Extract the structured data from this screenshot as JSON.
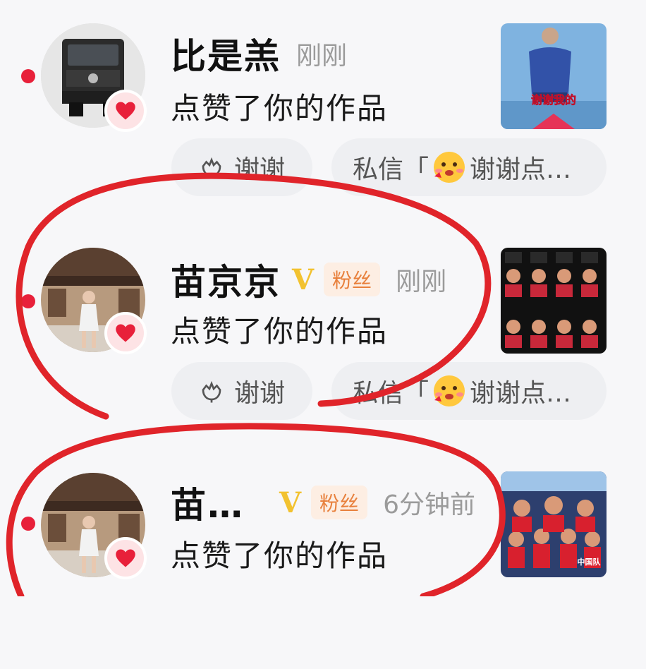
{
  "notifications": [
    {
      "name": "比是羔",
      "badge": "",
      "time": "刚刚",
      "action": "点赞了你的作品",
      "thanks_label": "谢谢",
      "message_prefix": "私信「",
      "message_text": "谢谢点…",
      "avatar": "truck-photo",
      "thumbnail": "video-cover-man-on-stage",
      "thumbnail_caption": "谢谢我的"
    },
    {
      "name": "苗京京",
      "verified": "V",
      "badge": "粉丝",
      "time": "刚刚",
      "action": "点赞了你的作品",
      "thanks_label": "谢谢",
      "message_prefix": "私信「",
      "message_text": "谢谢点…",
      "avatar": "girl-street-photo",
      "thumbnail": "table-tennis-player-grid"
    },
    {
      "name": "苗…",
      "verified": "V",
      "badge": "粉丝",
      "time": "6分钟前",
      "action": "点赞了你的作品",
      "avatar": "girl-street-photo",
      "thumbnail": "china-table-tennis-team-poster",
      "thumbnail_caption": "中国队"
    }
  ],
  "colors": {
    "unread_dot": "#e8203a",
    "heart": "#e8203a",
    "verified": "#f2c230",
    "fan_badge_text": "#e8803c",
    "annotation_ink": "#e0242a"
  }
}
